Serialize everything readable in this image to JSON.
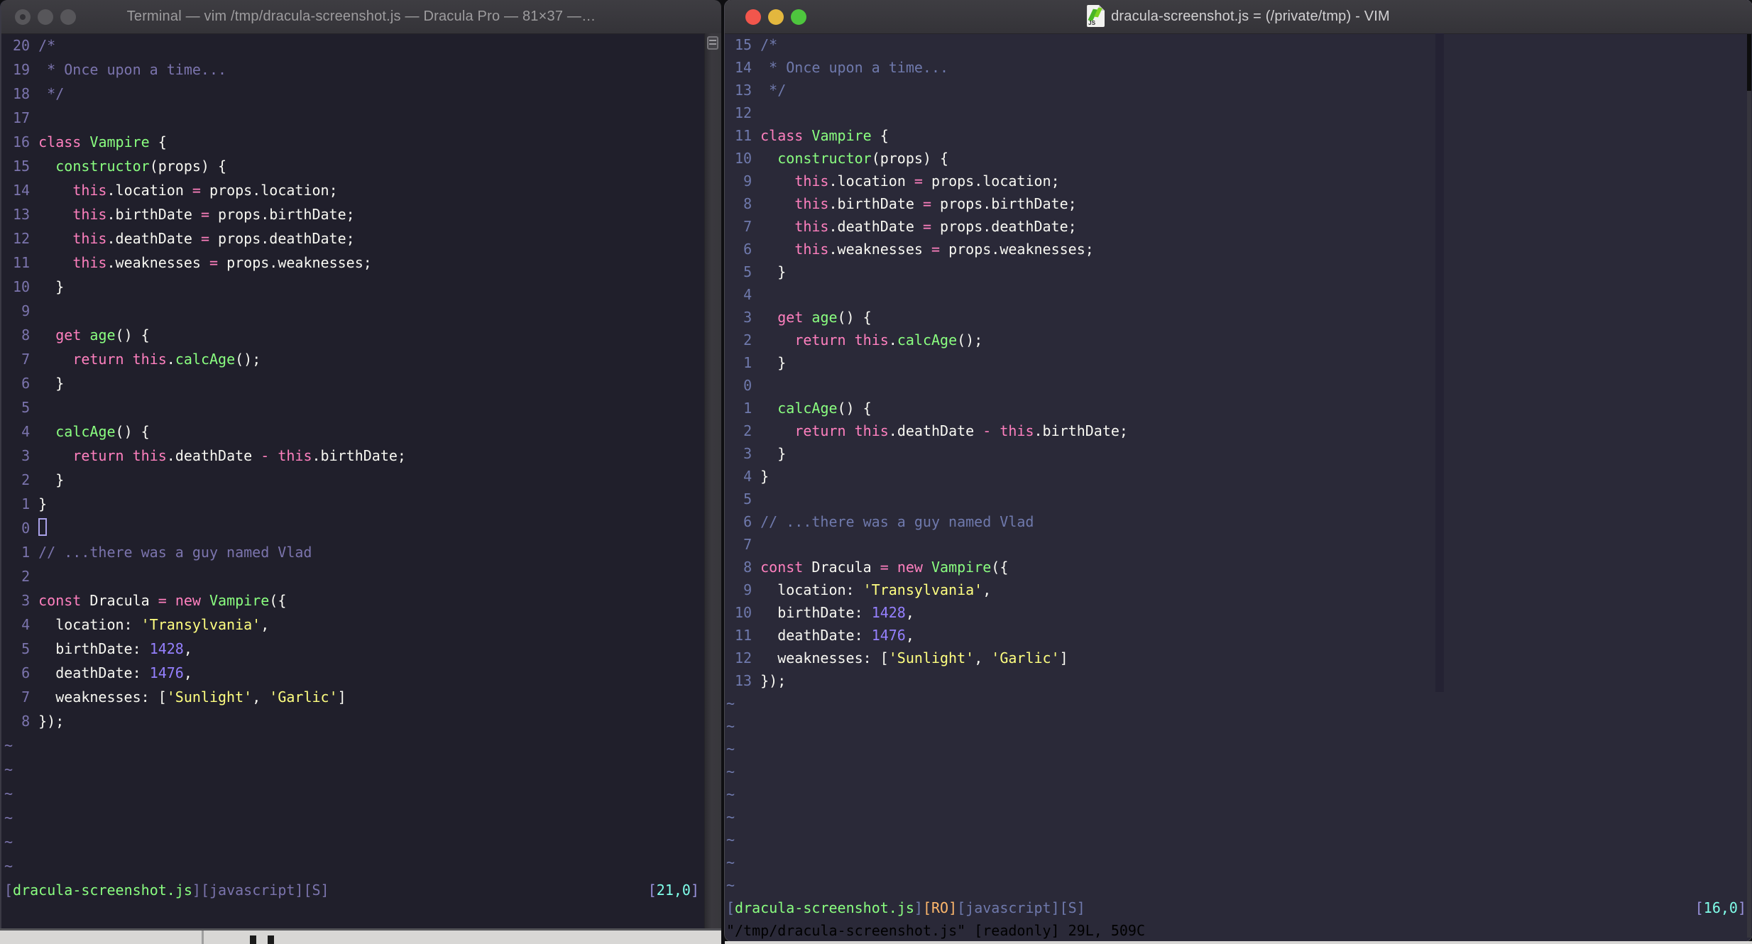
{
  "palette": {
    "bg_left": "#201F2B",
    "bg_right": "#2A2938",
    "fg": "#F8F8F2",
    "comment_left": "#7B74AD",
    "comment_right": "#6F79AC",
    "pink": "#FF80BF",
    "green": "#8AFF80",
    "purple": "#9580FF",
    "yellow": "#FFFF80",
    "cyan": "#80FFEA",
    "orange": "#FFB86C",
    "bracket": "#9A93DD",
    "cursor_outline": "#A9A1E8",
    "colorcolumn": "#242233",
    "title_text_left": "#9D9C9E",
    "title_text_right": "#D2D1D3",
    "inactive_button": "#57565A",
    "traffic_red": "#F2564C",
    "traffic_yellow": "#E3B73E",
    "traffic_green": "#4EC63E",
    "strip": "#D8D7D5"
  },
  "code_lines": [
    [
      [
        "cm",
        "/*"
      ]
    ],
    [
      [
        "cm",
        " * Once upon a time..."
      ]
    ],
    [
      [
        "cm",
        " */"
      ]
    ],
    [],
    [
      [
        "pk",
        "class"
      ],
      [
        "fg",
        " "
      ],
      [
        "gn",
        "Vampire"
      ],
      [
        "fg",
        " {"
      ]
    ],
    [
      [
        "fg",
        "  "
      ],
      [
        "gn",
        "constructor"
      ],
      [
        "fg",
        "(props) {"
      ]
    ],
    [
      [
        "fg",
        "    "
      ],
      [
        "pk",
        "this"
      ],
      [
        "fg",
        ".location "
      ],
      [
        "pk",
        "="
      ],
      [
        "fg",
        " props.location;"
      ]
    ],
    [
      [
        "fg",
        "    "
      ],
      [
        "pk",
        "this"
      ],
      [
        "fg",
        ".birthDate "
      ],
      [
        "pk",
        "="
      ],
      [
        "fg",
        " props.birthDate;"
      ]
    ],
    [
      [
        "fg",
        "    "
      ],
      [
        "pk",
        "this"
      ],
      [
        "fg",
        ".deathDate "
      ],
      [
        "pk",
        "="
      ],
      [
        "fg",
        " props.deathDate;"
      ]
    ],
    [
      [
        "fg",
        "    "
      ],
      [
        "pk",
        "this"
      ],
      [
        "fg",
        ".weaknesses "
      ],
      [
        "pk",
        "="
      ],
      [
        "fg",
        " props.weaknesses;"
      ]
    ],
    [
      [
        "fg",
        "  }"
      ]
    ],
    [],
    [
      [
        "fg",
        "  "
      ],
      [
        "pk",
        "get"
      ],
      [
        "fg",
        " "
      ],
      [
        "gn",
        "age"
      ],
      [
        "fg",
        "() {"
      ]
    ],
    [
      [
        "fg",
        "    "
      ],
      [
        "pk",
        "return"
      ],
      [
        "fg",
        " "
      ],
      [
        "pk",
        "this"
      ],
      [
        "fg",
        "."
      ],
      [
        "gn",
        "calcAge"
      ],
      [
        "fg",
        "();"
      ]
    ],
    [
      [
        "fg",
        "  }"
      ]
    ],
    [],
    [
      [
        "fg",
        "  "
      ],
      [
        "gn",
        "calcAge"
      ],
      [
        "fg",
        "() {"
      ]
    ],
    [
      [
        "fg",
        "    "
      ],
      [
        "pk",
        "return"
      ],
      [
        "fg",
        " "
      ],
      [
        "pk",
        "this"
      ],
      [
        "fg",
        ".deathDate "
      ],
      [
        "pk",
        "-"
      ],
      [
        "fg",
        " "
      ],
      [
        "pk",
        "this"
      ],
      [
        "fg",
        ".birthDate;"
      ]
    ],
    [
      [
        "fg",
        "  }"
      ]
    ],
    [
      [
        "fg",
        "}"
      ]
    ],
    [],
    [
      [
        "cm",
        "// ...there was a guy named Vlad"
      ]
    ],
    [],
    [
      [
        "pk",
        "const"
      ],
      [
        "fg",
        " Dracula "
      ],
      [
        "pk",
        "="
      ],
      [
        "fg",
        " "
      ],
      [
        "pk",
        "new"
      ],
      [
        "fg",
        " "
      ],
      [
        "gn",
        "Vampire"
      ],
      [
        "fg",
        "({"
      ]
    ],
    [
      [
        "fg",
        "  location: "
      ],
      [
        "ye",
        "'Transylvania'"
      ],
      [
        "fg",
        ","
      ]
    ],
    [
      [
        "fg",
        "  birthDate: "
      ],
      [
        "pu",
        "1428"
      ],
      [
        "fg",
        ","
      ]
    ],
    [
      [
        "fg",
        "  deathDate: "
      ],
      [
        "pu",
        "1476"
      ],
      [
        "fg",
        ","
      ]
    ],
    [
      [
        "fg",
        "  weaknesses: ["
      ],
      [
        "ye",
        "'Sunlight'"
      ],
      [
        "fg",
        ", "
      ],
      [
        "ye",
        "'Garlic'"
      ],
      [
        "fg",
        "]"
      ]
    ],
    [
      [
        "fg",
        "});"
      ]
    ]
  ],
  "left_window": {
    "title": "Terminal — vim /tmp/dracula-screenshot.js — Dracula Pro — 81×37 —…",
    "buttons": [
      "close",
      "minimize",
      "zoom"
    ],
    "numbers": [
      "20",
      "19",
      "18",
      "17",
      "16",
      "15",
      "14",
      "13",
      "12",
      "11",
      "10",
      "9",
      "8",
      "7",
      "6",
      "5",
      "4",
      "3",
      "2",
      "1",
      "0",
      "1",
      "2",
      "3",
      "4",
      "5",
      "6",
      "7",
      "8"
    ],
    "cursor": {
      "row": 20,
      "col": 0
    },
    "tilde_count": 6,
    "status_left": [
      [
        "cm",
        "["
      ],
      [
        "gn",
        "dracula-screenshot.js"
      ],
      [
        "cm",
        "]"
      ],
      [
        "cm",
        "[javascript][S]"
      ]
    ],
    "status_right": [
      [
        "br",
        "["
      ],
      [
        "cy",
        "21,0"
      ],
      [
        "br",
        "]"
      ]
    ],
    "command_line": ""
  },
  "right_window": {
    "title": "dracula-screenshot.js = (/private/tmp) - VIM",
    "buttons": [
      "close",
      "minimize",
      "zoom"
    ],
    "file_icon": "js-document-icon",
    "numbers": [
      "15",
      "14",
      "13",
      "12",
      "11",
      "10",
      "9",
      "8",
      "7",
      "6",
      "5",
      "4",
      "3",
      "2",
      "1",
      "0",
      "1",
      "2",
      "3",
      "4",
      "5",
      "6",
      "7",
      "8",
      "9",
      "10",
      "11",
      "12",
      "13"
    ],
    "cursor": null,
    "tilde_count": 9,
    "status_left": [
      [
        "cm",
        "["
      ],
      [
        "gn",
        "dracula-screenshot.js"
      ],
      [
        "cm",
        "]"
      ],
      [
        "or",
        "[RO]"
      ],
      [
        "cm",
        "[javascript][S]"
      ]
    ],
    "status_right": [
      [
        "br",
        "["
      ],
      [
        "cy",
        "16,0"
      ],
      [
        "br",
        "]"
      ]
    ],
    "command_line": "\"/tmp/dracula-screenshot.js\" [readonly] 29L, 509C"
  }
}
